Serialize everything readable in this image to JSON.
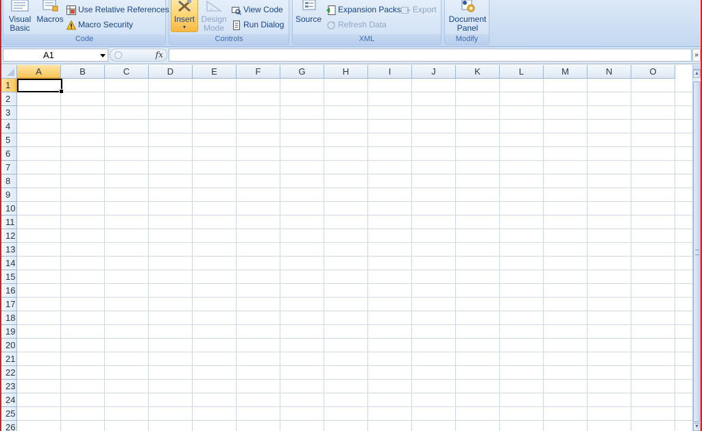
{
  "ribbon": {
    "code": {
      "label": "Code",
      "visual_basic": "Visual\nBasic",
      "visual_basic_line1": "Visual",
      "visual_basic_line2": "Basic",
      "macros": "Macros",
      "relative_refs": "Use Relative References",
      "macro_security": "Macro Security"
    },
    "controls": {
      "label": "Controls",
      "insert": "Insert",
      "design_mode_line1": "Design",
      "design_mode_line2": "Mode",
      "view_code": "View Code",
      "run_dialog": "Run Dialog"
    },
    "xml": {
      "label": "XML",
      "source": "Source",
      "expansion_packs": "Expansion Packs",
      "refresh_data": "Refresh Data",
      "export": "Export"
    },
    "modify": {
      "label": "Modify",
      "document_panel_line1": "Document",
      "document_panel_line2": "Panel"
    }
  },
  "formula_bar": {
    "name_box": "A1",
    "fx": "fx",
    "value": ""
  },
  "sheet": {
    "columns": [
      "A",
      "B",
      "C",
      "D",
      "E",
      "F",
      "G",
      "H",
      "I",
      "J",
      "K",
      "L",
      "M",
      "N",
      "O"
    ],
    "rows": [
      "1",
      "2",
      "3",
      "4",
      "5",
      "6",
      "7",
      "8",
      "9",
      "10",
      "11",
      "12",
      "13",
      "14",
      "15",
      "16",
      "17",
      "18",
      "19",
      "20",
      "21",
      "22",
      "23",
      "24",
      "25",
      "26"
    ],
    "active_cell": "A1"
  },
  "colors": {
    "selection_header": "#f8c55a",
    "frame": "#e21b1b",
    "ribbon_text": "#15428b"
  }
}
